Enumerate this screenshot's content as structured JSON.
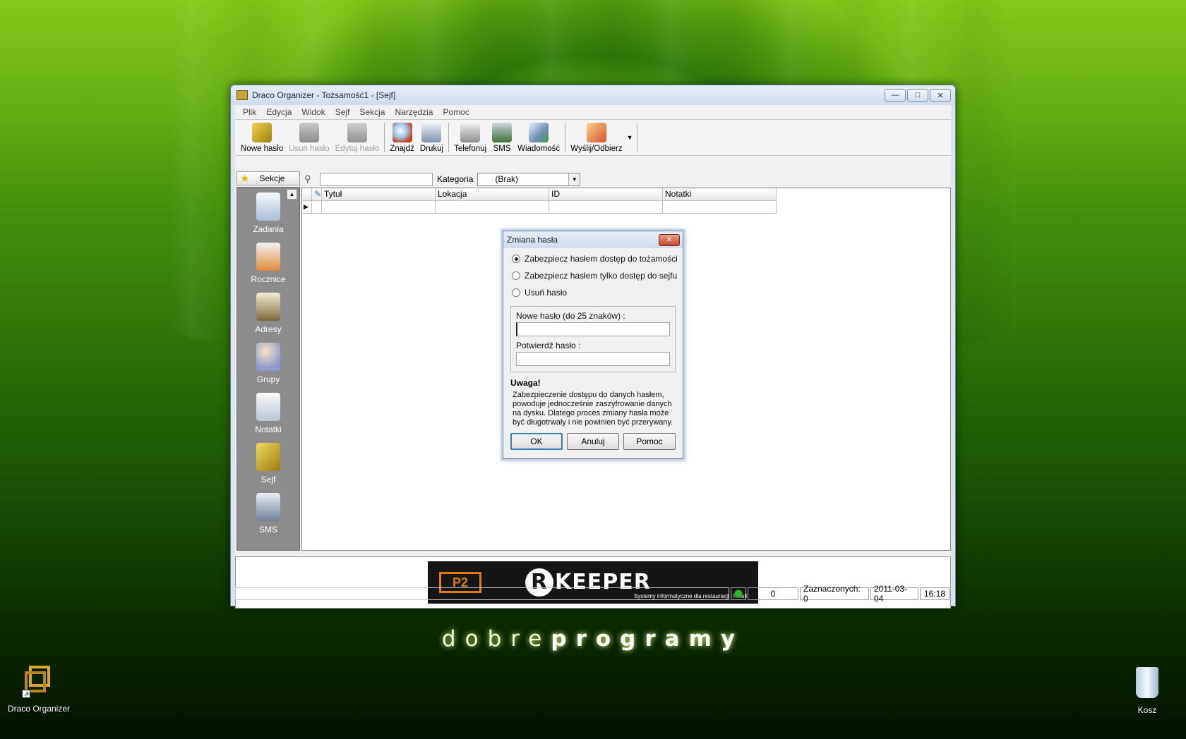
{
  "desktop": {
    "brand_light": "dobre",
    "brand_bold": "programy",
    "icons": [
      {
        "label": "Draco Organizer",
        "icon": "draco-shortcut-icon"
      },
      {
        "label": "Kosz",
        "icon": "recycle-bin-icon"
      }
    ]
  },
  "window": {
    "title": "Draco Organizer - Tożsamość1 - [Sejf]",
    "controls": [
      "minimize",
      "maximize",
      "close"
    ],
    "menu": [
      "Plik",
      "Edycja",
      "Widok",
      "Sejf",
      "Sekcja",
      "Narzędzia",
      "Pomoc"
    ],
    "toolbar": [
      {
        "label": "Nowe hasło",
        "enabled": true,
        "icon": "key-new-icon"
      },
      {
        "label": "Usuń hasło",
        "enabled": false,
        "icon": "trash-icon"
      },
      {
        "label": "Edytuj hasło",
        "enabled": false,
        "icon": "edit-icon"
      },
      {
        "label": "Znajdź",
        "enabled": true,
        "icon": "search-icon"
      },
      {
        "label": "Drukuj",
        "enabled": true,
        "icon": "printer-icon"
      },
      {
        "label": "Telefonuj",
        "enabled": true,
        "icon": "phone-icon"
      },
      {
        "label": "SMS",
        "enabled": true,
        "icon": "mobile-icon"
      },
      {
        "label": "Wiadomość",
        "enabled": true,
        "icon": "envelope-icon"
      },
      {
        "label": "Wyślij/Odbierz",
        "enabled": true,
        "icon": "send-receive-icon"
      }
    ],
    "sections_header": "Sekcje",
    "sections": [
      {
        "label": "Zadania",
        "icon": "tasks-icon"
      },
      {
        "label": "Rocznice",
        "icon": "anniversary-icon"
      },
      {
        "label": "Adresy",
        "icon": "address-book-icon"
      },
      {
        "label": "Grupy",
        "icon": "groups-icon"
      },
      {
        "label": "Notatki",
        "icon": "notes-icon"
      },
      {
        "label": "Sejf",
        "icon": "vault-key-icon"
      },
      {
        "label": "SMS",
        "icon": "sms-phone-icon"
      }
    ],
    "filter": {
      "search_value": "",
      "category_label": "Kategoria",
      "category_value": "(Brak)"
    },
    "grid": {
      "columns": [
        "Tytuł",
        "Lokacja",
        "ID",
        "Notatki"
      ],
      "rows": [
        [
          "",
          "",
          "",
          ""
        ]
      ]
    },
    "banner": {
      "brand": "KEEPER",
      "brand_initial": "R",
      "tagline": "Systemy informatyczne dla restauracji i hoteli"
    },
    "status": {
      "count": "0",
      "selected": "Zaznaczonych: 0",
      "date": "2011-03-04",
      "time": "16:18",
      "indicator_color": "#2fb52f"
    }
  },
  "dialog": {
    "title": "Zmiana hasła",
    "options": [
      {
        "label": "Zabezpiecz hasłem dostęp do tożamości",
        "selected": true
      },
      {
        "label": "Zabezpiecz hasłem tylko dostęp do sejfu",
        "selected": false
      },
      {
        "label": "Usuń hasło",
        "selected": false
      }
    ],
    "new_password_label": "Nowe hasło (do 25 znaków) :",
    "new_password_value": "",
    "confirm_password_label": "Potwierdź hasło :",
    "confirm_password_value": "",
    "warning_title": "Uwaga!",
    "warning_text": "Zabezpieczenie dostępu do danych hasłem, powoduje jednocześnie zaszyfrowanie danych na dysku. Dlatego proces zmiany hasła może być długotrwały i nie powinien być przerywany.",
    "buttons": [
      "OK",
      "Anuluj",
      "Pomoc"
    ]
  }
}
